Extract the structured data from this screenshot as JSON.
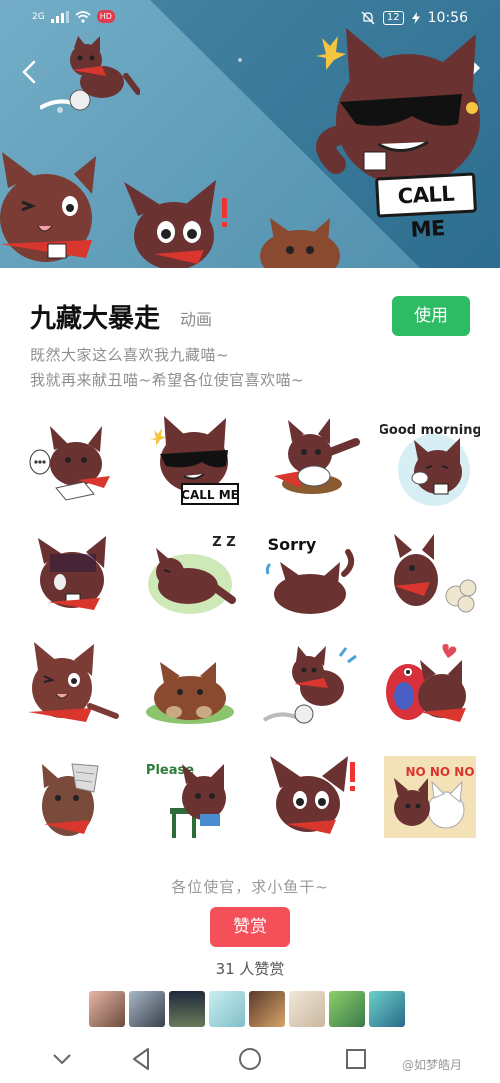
{
  "status_bar": {
    "network": "2G",
    "badge": "HD",
    "battery": "12",
    "time": "10:56"
  },
  "hero": {
    "callme_text": "CALL ME"
  },
  "pack": {
    "title": "九藏大暴走",
    "category": "动画",
    "use_label": "使用",
    "description": [
      "既然大家这么喜欢我九藏喵~",
      "我就再来献丑喵~希望各位使官喜欢喵~"
    ]
  },
  "stickers": [
    {
      "name": "sticker-cat-typing",
      "text": ""
    },
    {
      "name": "sticker-cat-sunglasses-call-me",
      "text": "CALL ME"
    },
    {
      "name": "sticker-cat-fighting-pose",
      "text": ""
    },
    {
      "name": "sticker-cat-good-morning",
      "text": "Good morning"
    },
    {
      "name": "sticker-cat-gloomy",
      "text": ""
    },
    {
      "name": "sticker-cat-sleeping",
      "text": "Z Z"
    },
    {
      "name": "sticker-cat-sorry",
      "text": "Sorry"
    },
    {
      "name": "sticker-cat-farting",
      "text": ""
    },
    {
      "name": "sticker-cat-tongue-out",
      "text": ""
    },
    {
      "name": "sticker-cat-lying-down",
      "text": ""
    },
    {
      "name": "sticker-cat-running",
      "text": ""
    },
    {
      "name": "sticker-cat-with-parrot",
      "text": ""
    },
    {
      "name": "sticker-cat-bandaged",
      "text": ""
    },
    {
      "name": "sticker-cat-please",
      "text": "Please"
    },
    {
      "name": "sticker-cat-surprised",
      "text": ""
    },
    {
      "name": "sticker-cat-no-no-no",
      "text": "NO NO NO"
    }
  ],
  "reward": {
    "tip": "各位使官，求小鱼干~",
    "button_label": "赞赏",
    "count_text": "31 人赞赏"
  },
  "watermark": "@如梦皓月",
  "colors": {
    "use_button": "#2dbb63",
    "reward_button": "#f4505a",
    "cat_body": "#6b3232",
    "scarf": "#d9362e"
  }
}
